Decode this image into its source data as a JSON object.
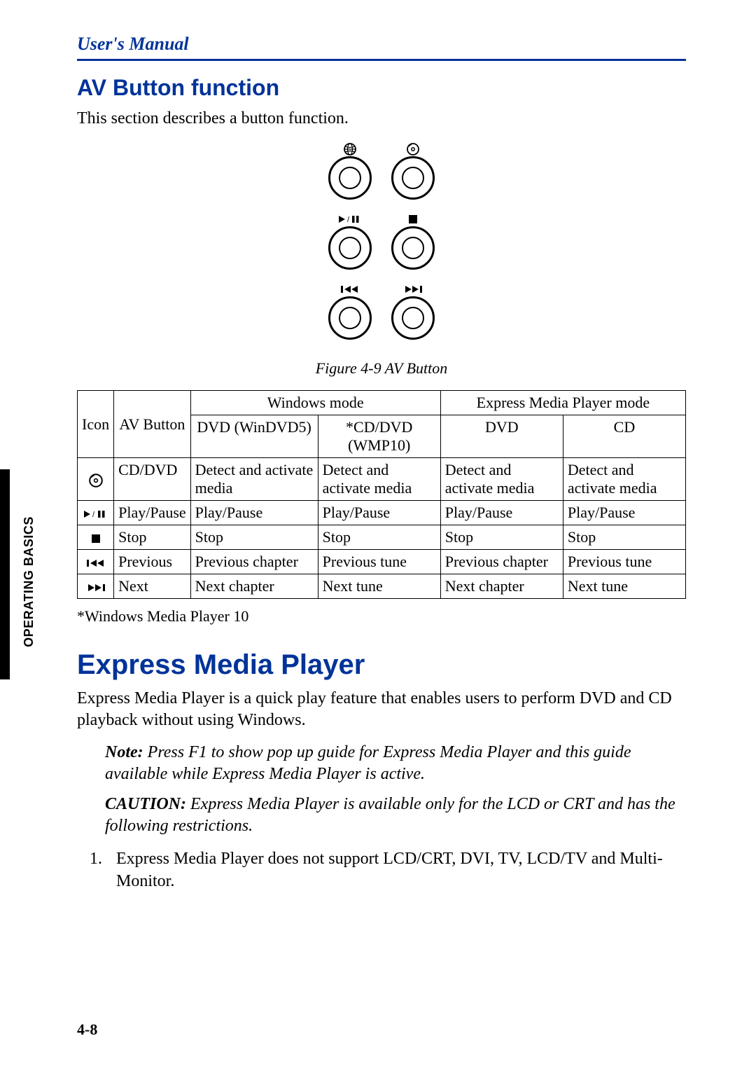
{
  "header": {
    "running_head": "User's Manual"
  },
  "section1": {
    "heading": "AV Button function",
    "intro": "This section describes a button function.",
    "figure_caption": "Figure 4-9 AV Button"
  },
  "table": {
    "mode_windows": "Windows mode",
    "mode_express": "Express Media Player mode",
    "col_icon": "Icon",
    "col_button": "AV Button",
    "col_dvd_win": "DVD (WinDVD5)",
    "col_cddvd_wmp": "*CD/DVD (WMP10)",
    "col_dvd": "DVD",
    "col_cd": "CD",
    "rows": [
      {
        "icon": "cd-dvd",
        "button": "CD/DVD",
        "c1": "Detect and activate media",
        "c2": "Detect and activate media",
        "c3": "Detect and activate media",
        "c4": "Detect and activate media"
      },
      {
        "icon": "play-pause",
        "button": "Play/Pause",
        "c1": "Play/Pause",
        "c2": "Play/Pause",
        "c3": "Play/Pause",
        "c4": "Play/Pause"
      },
      {
        "icon": "stop",
        "button": "Stop",
        "c1": "Stop",
        "c2": "Stop",
        "c3": "Stop",
        "c4": "Stop"
      },
      {
        "icon": "prev",
        "button": "Previous",
        "c1": "Previous chapter",
        "c2": "Previous tune",
        "c3": "Previous chapter",
        "c4": "Previous tune"
      },
      {
        "icon": "next",
        "button": "Next",
        "c1": "Next chapter",
        "c2": "Next tune",
        "c3": "Next chapter",
        "c4": "Next tune"
      }
    ],
    "footnote": "*Windows Media Player 10"
  },
  "section2": {
    "heading": "Express Media Player",
    "para1": "Express Media Player is a quick play feature that enables users to perform DVD and CD playback without using Windows.",
    "note_label": "Note:",
    "note_text": " Press F1 to show pop up guide for Express Media Player and this guide available while Express Media Player is active.",
    "caution_label": "CAUTION:",
    "caution_text": " Express Media Player is available only for the LCD or CRT and has the following restrictions.",
    "list": [
      "Express Media Player does not support LCD/CRT, DVI, TV, LCD/TV and Multi-Monitor."
    ]
  },
  "side_tab_a": "O",
  "side_tab_b": "PERATING",
  "side_tab_c": " B",
  "side_tab_d": "ASICS",
  "page_number": "4-8"
}
